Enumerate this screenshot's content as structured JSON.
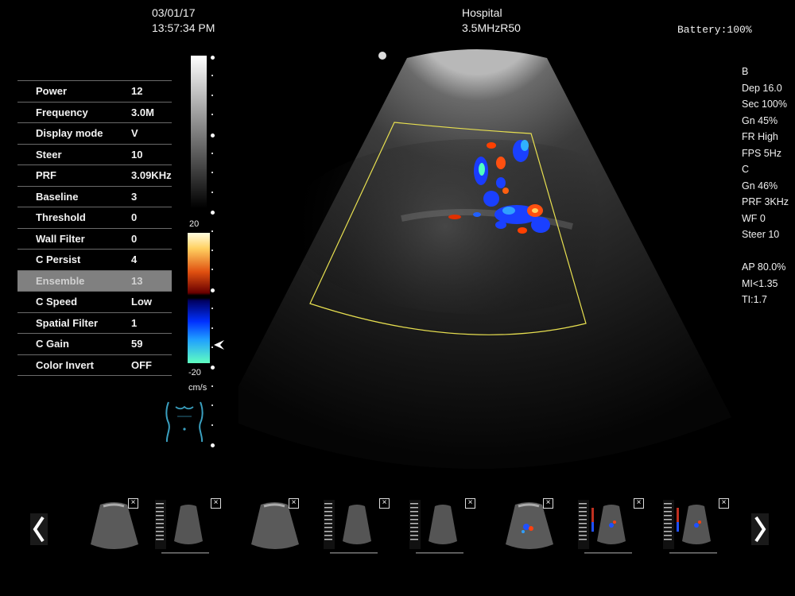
{
  "header": {
    "date": "03/01/17",
    "time": "13:57:34 PM",
    "hospital": "Hospital",
    "probe": "3.5MHzR50",
    "battery": "Battery:100%"
  },
  "menu": [
    {
      "label": "Power",
      "value": "12"
    },
    {
      "label": "Frequency",
      "value": "3.0M"
    },
    {
      "label": "Display mode",
      "value": "V"
    },
    {
      "label": "Steer",
      "value": "10"
    },
    {
      "label": "PRF",
      "value": "3.09KHz"
    },
    {
      "label": "Baseline",
      "value": "3"
    },
    {
      "label": "Threshold",
      "value": "0"
    },
    {
      "label": "Wall Filter",
      "value": "0"
    },
    {
      "label": "C Persist",
      "value": "4"
    },
    {
      "label": "Ensemble",
      "value": "13",
      "selected": true
    },
    {
      "label": "C Speed",
      "value": "Low"
    },
    {
      "label": "Spatial Filter",
      "value": "1"
    },
    {
      "label": "C Gain",
      "value": "59"
    },
    {
      "label": "Color Invert",
      "value": "OFF"
    }
  ],
  "scale": {
    "top": "20",
    "bottom": "-20",
    "unit": "cm/s"
  },
  "info": {
    "b_lines": [
      "B",
      "Dep 16.0",
      "Sec 100%",
      "Gn 45%",
      "FR High",
      "FPS 5Hz"
    ],
    "c_lines": [
      "C",
      "Gn  46%",
      "PRF 3KHz",
      "WF 0",
      "Steer 10"
    ],
    "safety_lines": [
      "AP 80.0%",
      "MI<1.35",
      "TI:1.7"
    ]
  },
  "thumbnails": [
    {
      "kind": "b-mode"
    },
    {
      "kind": "split"
    },
    {
      "kind": "b-mode"
    },
    {
      "kind": "split"
    },
    {
      "kind": "split"
    },
    {
      "kind": "color"
    },
    {
      "kind": "split-color"
    },
    {
      "kind": "split-color"
    }
  ],
  "colors": {
    "roi": "#e8e050",
    "body_marker": "#3aa0c0",
    "selected_row": "#808080"
  },
  "icons": {
    "prev": "chevron-left-icon",
    "next": "chevron-right-icon",
    "close": "close-icon",
    "probe_marker": "probe-orientation-icon",
    "pointer": "baseline-pointer-icon"
  }
}
